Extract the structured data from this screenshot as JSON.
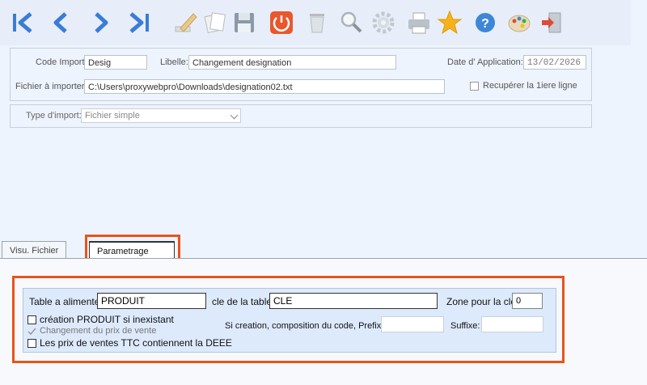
{
  "toolbar": {
    "buttons": [
      {
        "name": "first-record-button",
        "icon": "skip-first-icon"
      },
      {
        "name": "previous-record-button",
        "icon": "chevron-left-icon"
      },
      {
        "name": "next-record-button",
        "icon": "chevron-right-icon"
      },
      {
        "name": "last-record-button",
        "icon": "skip-last-icon"
      },
      {
        "name": "edit-button",
        "icon": "pencil-icon"
      },
      {
        "name": "copy-button",
        "icon": "copy-icon"
      },
      {
        "name": "save-button",
        "icon": "save-icon"
      },
      {
        "name": "power-button",
        "icon": "power-icon"
      },
      {
        "name": "delete-button",
        "icon": "trash-icon"
      },
      {
        "name": "search-button",
        "icon": "search-icon"
      },
      {
        "name": "settings-button",
        "icon": "gear-icon"
      },
      {
        "name": "print-button",
        "icon": "printer-icon"
      },
      {
        "name": "favorite-button",
        "icon": "star-icon"
      },
      {
        "name": "help-button",
        "icon": "help-icon"
      },
      {
        "name": "palette-button",
        "icon": "palette-icon"
      },
      {
        "name": "exit-button",
        "icon": "exit-icon"
      }
    ],
    "colors": {
      "nav": "#3a7cd6",
      "power": "#e9572d",
      "star": "#f5b21a",
      "help": "#3e86d8"
    }
  },
  "form": {
    "code_import_label": "Code Import:",
    "code_import_value": "Desig",
    "libelle_label": "Libelle:",
    "libelle_value": "Changement designation",
    "date_label": "Date d' Application:",
    "date_value": "13/02/2026",
    "fichier_label": "Fichier à importer:",
    "fichier_value": "C:\\Users\\proxywebpro\\Downloads\\designation02.txt",
    "recuperer_label": "Recupérer la 1iere ligne",
    "type_label": "Type d'import:",
    "type_value": "Fichier simple"
  },
  "tabs": [
    {
      "label": "Visu. Fichier"
    },
    {
      "label": "Parametrage",
      "active": true
    }
  ],
  "parametrage": {
    "table_label": "Table a alimenter:",
    "table_value": "PRODUIT",
    "cle_label": "cle de la table:",
    "cle_value": "CLE",
    "zone_label": "Zone pour la cle:",
    "zone_value": "0",
    "creation_label": "création PRODUIT si inexistant",
    "changement_label": "Changement du prix de vente",
    "ttc_label": "Les prix de ventes TTC contiennent la DEEE",
    "composition_label": "Si creation, composition du code, Prefixe:",
    "prefixe_value": "",
    "suffixe_label": "Suffixe:",
    "suffixe_value": ""
  },
  "accent_color": "#e8541c"
}
